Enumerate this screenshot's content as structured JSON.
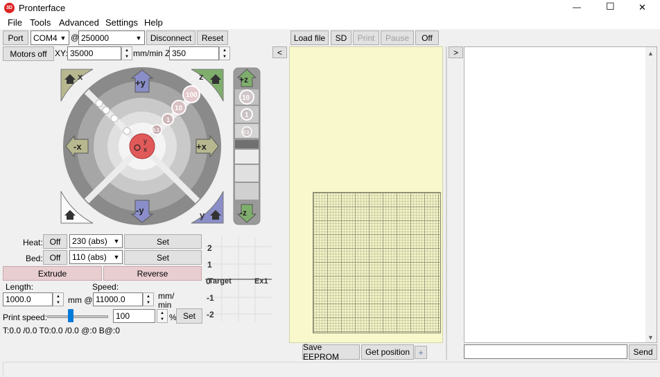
{
  "window": {
    "title": "Pronterface",
    "min": "—",
    "max": "☐",
    "close": "✕",
    "logo": "3D"
  },
  "menu": [
    "File",
    "Tools",
    "Advanced",
    "Settings",
    "Help"
  ],
  "conn": {
    "port_label": "Port",
    "port_value": "COM4",
    "at": "@",
    "baud_value": "250000",
    "disconnect": "Disconnect",
    "reset": "Reset"
  },
  "motors": {
    "off_label": "Motors off",
    "xy_label": "XY:",
    "xy_value": "35000",
    "unit": "mm/min Z:",
    "z_value": "350"
  },
  "jog": {
    "home_x": "x",
    "home_z": "z",
    "home_y": "y",
    "plus_y": "+y",
    "minus_y": "-y",
    "minus_x": "-x",
    "plus_x": "+x",
    "steps": [
      "100",
      "10",
      "1",
      "0.1"
    ],
    "center_y": "y",
    "center_x": "x",
    "plus_z": "+z",
    "minus_z": "-z",
    "z_steps": [
      "10",
      "1",
      "0.1"
    ]
  },
  "temps": {
    "heat_label": "Heat:",
    "heat_off": "Off",
    "heat_value": "230 (abs)",
    "heat_set": "Set",
    "bed_label": "Bed:",
    "bed_off": "Off",
    "bed_value": "110 (abs)",
    "bed_set": "Set"
  },
  "extrude": {
    "extrude": "Extrude",
    "reverse": "Reverse",
    "length_label": "Length:",
    "length_value": "1000.0",
    "mm_at": "mm @",
    "speed_label": "Speed:",
    "speed_value": "11000.0",
    "mm_label": "mm/",
    "min_label": "min"
  },
  "print_speed": {
    "label": "Print speed:",
    "value": "100",
    "pct": "%",
    "set": "Set"
  },
  "status_line": "T:0.0 /0.0 T0:0.0 /0.0 @:0 B@:0",
  "graph": {
    "ticks": [
      "2",
      "1",
      "0",
      "-1",
      "-2"
    ],
    "target": "Target",
    "ex": "Ex1"
  },
  "toolbar": {
    "load": "Load file",
    "sd": "SD",
    "print": "Print",
    "pause": "Pause",
    "off": "Off"
  },
  "collapse_left": "<",
  "collapse_right": ">",
  "bottom": {
    "save_eeprom": "Save EEPROM",
    "get_position": "Get position",
    "plus": "+"
  },
  "console": {
    "send": "Send",
    "input_value": ""
  },
  "colors": {
    "bed": "#f8f8cc",
    "grid": "#a9a98a",
    "pink": "#e8cdd1"
  }
}
